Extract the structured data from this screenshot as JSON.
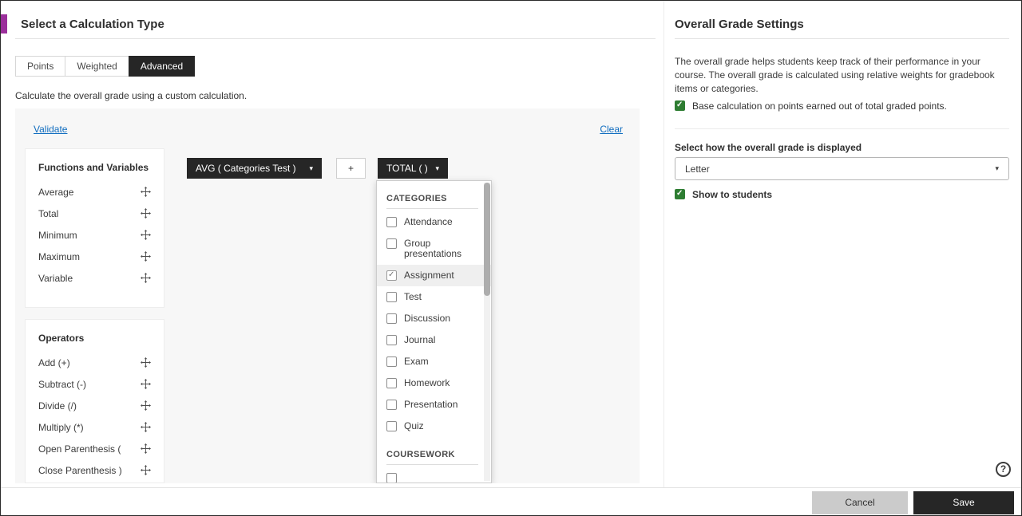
{
  "colors": {
    "accent_purple": "#9b2f9b",
    "link_blue": "#0f6cbf",
    "dark_button": "#262626",
    "checkbox_green": "#2e7d32",
    "highlight_row": "#efefef"
  },
  "icons": {
    "caret_down": "▾",
    "plus": "+",
    "help": "?"
  },
  "left": {
    "title": "Select a Calculation Type",
    "tabs": [
      {
        "label": "Points",
        "active": false
      },
      {
        "label": "Weighted",
        "active": false
      },
      {
        "label": "Advanced",
        "active": true
      }
    ],
    "description": "Calculate the overall grade using a custom calculation.",
    "validate_link": "Validate",
    "clear_link": "Clear",
    "functions_panel": {
      "title": "Functions and Variables",
      "items": [
        "Average",
        "Total",
        "Minimum",
        "Maximum",
        "Variable"
      ]
    },
    "operators_panel": {
      "title": "Operators",
      "items": [
        "Add (+)",
        "Subtract (-)",
        "Divide (/)",
        "Multiply (*)",
        "Open Parenthesis (",
        "Close Parenthesis )"
      ]
    },
    "expression": {
      "avg_chip": "AVG ( Categories Test )",
      "plus_chip": "+",
      "total_chip": "TOTAL ( )"
    },
    "dropdown": {
      "sections": [
        {
          "header": "CATEGORIES",
          "items": [
            {
              "label": "Attendance",
              "checked": false
            },
            {
              "label": "Group presentations",
              "checked": false
            },
            {
              "label": "Assignment",
              "checked": true,
              "highlight": true
            },
            {
              "label": "Test",
              "checked": false
            },
            {
              "label": "Discussion",
              "checked": false
            },
            {
              "label": "Journal",
              "checked": false
            },
            {
              "label": "Exam",
              "checked": false
            },
            {
              "label": "Homework",
              "checked": false
            },
            {
              "label": "Presentation",
              "checked": false
            },
            {
              "label": "Quiz",
              "checked": false
            }
          ]
        },
        {
          "header": "COURSEWORK",
          "items": [
            {
              "label": "",
              "checked": false
            }
          ]
        }
      ]
    }
  },
  "right": {
    "title": "Overall Grade Settings",
    "description": "The overall grade helps students keep track of their performance in your course. The overall grade is calculated using relative weights for gradebook items or categories.",
    "base_calculation_checkbox": {
      "label": "Base calculation on points earned out of total graded points.",
      "checked": true
    },
    "display_label": "Select how the overall grade is displayed",
    "display_select": {
      "value": "Letter"
    },
    "show_to_students_checkbox": {
      "label": "Show to students",
      "checked": true
    }
  },
  "footer": {
    "cancel_label": "Cancel",
    "save_label": "Save"
  }
}
